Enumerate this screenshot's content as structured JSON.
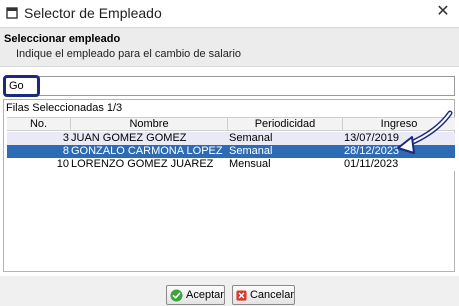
{
  "window": {
    "title": "Selector de Empleado",
    "icon": "window-icon",
    "close_icon": "close-icon"
  },
  "header": {
    "title": "Seleccionar empleado",
    "subtitle": "Indique el empleado para el cambio de salario"
  },
  "search": {
    "value": "Go"
  },
  "table": {
    "rows_label": "Filas Seleccionadas  1/3",
    "columns": [
      "No.",
      "Nombre",
      "Periodicidad",
      "Ingreso"
    ],
    "rows": [
      {
        "no": "3",
        "nombre": "JUAN GOMEZ GOMEZ",
        "periodicidad": "Semanal",
        "ingreso": "13/07/2019"
      },
      {
        "no": "8",
        "nombre": "GONZALO CARMONA LOPEZ",
        "periodicidad": "Semanal",
        "ingreso": "28/12/2023"
      },
      {
        "no": "10",
        "nombre": "LORENZO GOMEZ JUAREZ",
        "periodicidad": "Mensual",
        "ingreso": "01/11/2023"
      }
    ],
    "selected_row": 1
  },
  "buttons": {
    "accept_label": "Aceptar",
    "cancel_label": "Cancelar",
    "accept_icon": "check-icon",
    "cancel_icon": "cancel-icon"
  },
  "colors": {
    "selection": "#2d6bb5",
    "row_alt": "#eaeaf7",
    "highlight_border": "#1b2a7a",
    "accept_icon": "#3aa33a",
    "cancel_icon": "#d93a2b"
  }
}
